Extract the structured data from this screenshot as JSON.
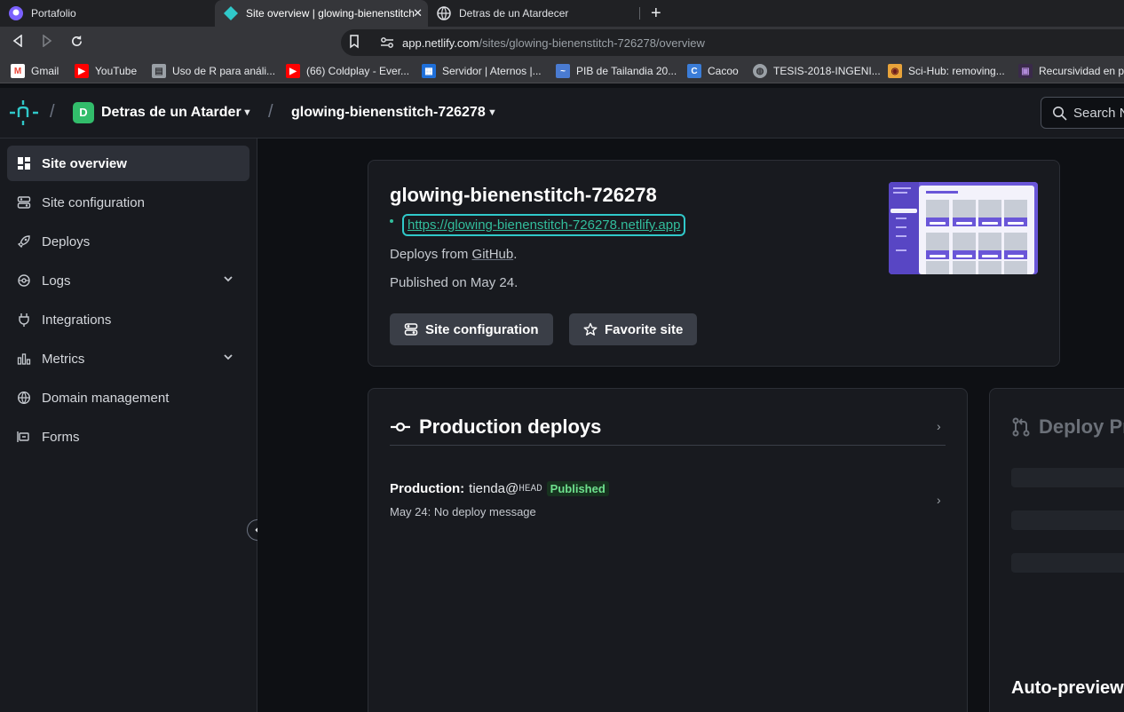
{
  "browser": {
    "tabs": [
      {
        "label": "Portafolio",
        "active": false
      },
      {
        "label": "Site overview | glowing-bienenstitch",
        "active": true
      },
      {
        "label": "Detras de un Atardecer",
        "active": false
      }
    ],
    "url_host": "app.netlify.com",
    "url_path": "/sites/glowing-bienenstitch-726278/overview",
    "bookmarks": [
      {
        "label": "Gmail",
        "icon": "gmail-icon"
      },
      {
        "label": "YouTube",
        "icon": "youtube-icon"
      },
      {
        "label": "Uso de R para análi...",
        "icon": "book-icon"
      },
      {
        "label": "(66) Coldplay - Ever...",
        "icon": "youtube-icon"
      },
      {
        "label": "Servidor | Aternos |...",
        "icon": "aternos-icon"
      },
      {
        "label": "PIB de Tailandia 20...",
        "icon": "chart-icon"
      },
      {
        "label": "Cacoo",
        "icon": "cacoo-icon"
      },
      {
        "label": "TESIS-2018-INGENI...",
        "icon": "globe-icon"
      },
      {
        "label": "Sci-Hub: removing...",
        "icon": "scihub-icon"
      },
      {
        "label": "Recursividad en pr",
        "icon": "video-icon"
      }
    ]
  },
  "header": {
    "team_initial": "D",
    "team_name": "Detras de un Atarder",
    "site_name": "glowing-bienenstitch-726278",
    "search_placeholder": "Search N"
  },
  "sidebar": {
    "items": [
      {
        "label": "Site overview",
        "icon": "grid-icon",
        "active": true
      },
      {
        "label": "Site configuration",
        "icon": "config-icon",
        "active": false
      },
      {
        "label": "Deploys",
        "icon": "rocket-icon",
        "active": false
      },
      {
        "label": "Logs",
        "icon": "logs-icon",
        "active": false,
        "expandable": true
      },
      {
        "label": "Integrations",
        "icon": "plug-icon",
        "active": false
      },
      {
        "label": "Metrics",
        "icon": "bar-chart-icon",
        "active": false,
        "expandable": true
      },
      {
        "label": "Domain management",
        "icon": "globe-icon",
        "active": false
      },
      {
        "label": "Forms",
        "icon": "forms-icon",
        "active": false
      }
    ]
  },
  "overview": {
    "title": "glowing-bienenstitch-726278",
    "link": "https://glowing-bienenstitch-726278.netlify.app",
    "deploys_from_prefix": "Deploys from",
    "deploys_from_source": "GitHub",
    "deploys_from_suffix": ".",
    "published_on": "Published on May 24.",
    "btn_config": "Site configuration",
    "btn_favorite": "Favorite site"
  },
  "production": {
    "title": "Production deploys",
    "label": "Production:",
    "branch": "tienda@",
    "ref": "HEAD",
    "status": "Published",
    "date_msg": "May 24: No deploy message"
  },
  "previews": {
    "title": "Deploy Pr",
    "auto_title": "Auto-preview"
  },
  "colors": {
    "accent": "#32bd9c",
    "team_badge": "#32bd6b",
    "published_bg": "#17331f",
    "published_fg": "#6ee08d"
  }
}
